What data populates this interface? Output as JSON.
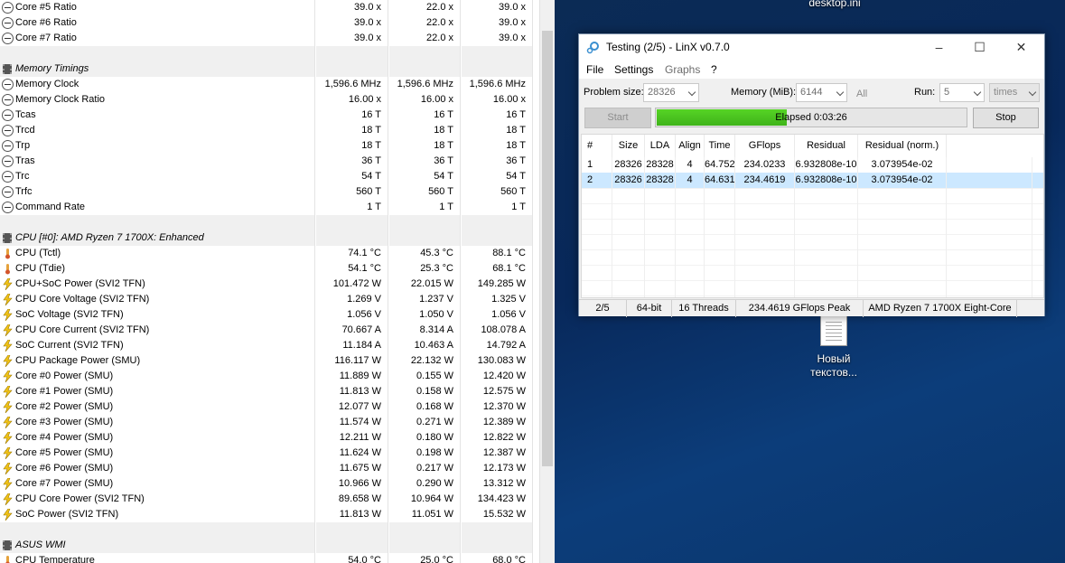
{
  "hwinfo": {
    "rows": [
      {
        "type": "sensor",
        "icon": "clock",
        "name": "Core #5 Ratio",
        "v1": "39.0 x",
        "v2": "22.0 x",
        "v3": "39.0 x"
      },
      {
        "type": "sensor",
        "icon": "clock",
        "name": "Core #6 Ratio",
        "v1": "39.0 x",
        "v2": "22.0 x",
        "v3": "39.0 x"
      },
      {
        "type": "sensor",
        "icon": "clock",
        "name": "Core #7 Ratio",
        "v1": "39.0 x",
        "v2": "22.0 x",
        "v3": "39.0 x"
      },
      {
        "type": "blank"
      },
      {
        "type": "group",
        "icon": "chip",
        "name": "Memory Timings"
      },
      {
        "type": "sensor",
        "icon": "clock",
        "name": "Memory Clock",
        "v1": "1,596.6 MHz",
        "v2": "1,596.6 MHz",
        "v3": "1,596.6 MHz"
      },
      {
        "type": "sensor",
        "icon": "clock",
        "name": "Memory Clock Ratio",
        "v1": "16.00 x",
        "v2": "16.00 x",
        "v3": "16.00 x"
      },
      {
        "type": "sensor",
        "icon": "clock",
        "name": "Tcas",
        "v1": "16 T",
        "v2": "16 T",
        "v3": "16 T"
      },
      {
        "type": "sensor",
        "icon": "clock",
        "name": "Trcd",
        "v1": "18 T",
        "v2": "18 T",
        "v3": "18 T"
      },
      {
        "type": "sensor",
        "icon": "clock",
        "name": "Trp",
        "v1": "18 T",
        "v2": "18 T",
        "v3": "18 T"
      },
      {
        "type": "sensor",
        "icon": "clock",
        "name": "Tras",
        "v1": "36 T",
        "v2": "36 T",
        "v3": "36 T"
      },
      {
        "type": "sensor",
        "icon": "clock",
        "name": "Trc",
        "v1": "54 T",
        "v2": "54 T",
        "v3": "54 T"
      },
      {
        "type": "sensor",
        "icon": "clock",
        "name": "Trfc",
        "v1": "560 T",
        "v2": "560 T",
        "v3": "560 T"
      },
      {
        "type": "sensor",
        "icon": "clock",
        "name": "Command Rate",
        "v1": "1 T",
        "v2": "1 T",
        "v3": "1 T"
      },
      {
        "type": "blank"
      },
      {
        "type": "group",
        "icon": "chip",
        "name": "CPU [#0]: AMD Ryzen 7 1700X: Enhanced"
      },
      {
        "type": "sensor",
        "icon": "temp",
        "name": "CPU (Tctl)",
        "v1": "74.1 °C",
        "v2": "45.3 °C",
        "v3": "88.1 °C"
      },
      {
        "type": "sensor",
        "icon": "temp",
        "name": "CPU (Tdie)",
        "v1": "54.1 °C",
        "v2": "25.3 °C",
        "v3": "68.1 °C"
      },
      {
        "type": "sensor",
        "icon": "volt",
        "name": "CPU+SoC Power (SVI2 TFN)",
        "v1": "101.472 W",
        "v2": "22.015 W",
        "v3": "149.285 W"
      },
      {
        "type": "sensor",
        "icon": "volt",
        "name": "CPU Core Voltage (SVI2 TFN)",
        "v1": "1.269 V",
        "v2": "1.237 V",
        "v3": "1.325 V"
      },
      {
        "type": "sensor",
        "icon": "volt",
        "name": "SoC Voltage (SVI2 TFN)",
        "v1": "1.056 V",
        "v2": "1.050 V",
        "v3": "1.056 V"
      },
      {
        "type": "sensor",
        "icon": "volt",
        "name": "CPU Core Current (SVI2 TFN)",
        "v1": "70.667 A",
        "v2": "8.314 A",
        "v3": "108.078 A"
      },
      {
        "type": "sensor",
        "icon": "volt",
        "name": "SoC Current (SVI2 TFN)",
        "v1": "11.184 A",
        "v2": "10.463 A",
        "v3": "14.792 A"
      },
      {
        "type": "sensor",
        "icon": "volt",
        "name": "CPU Package Power (SMU)",
        "v1": "116.117 W",
        "v2": "22.132 W",
        "v3": "130.083 W"
      },
      {
        "type": "sensor",
        "icon": "volt",
        "name": "Core #0 Power (SMU)",
        "v1": "11.889 W",
        "v2": "0.155 W",
        "v3": "12.420 W"
      },
      {
        "type": "sensor",
        "icon": "volt",
        "name": "Core #1 Power (SMU)",
        "v1": "11.813 W",
        "v2": "0.158 W",
        "v3": "12.575 W"
      },
      {
        "type": "sensor",
        "icon": "volt",
        "name": "Core #2 Power (SMU)",
        "v1": "12.077 W",
        "v2": "0.168 W",
        "v3": "12.370 W"
      },
      {
        "type": "sensor",
        "icon": "volt",
        "name": "Core #3 Power (SMU)",
        "v1": "11.574 W",
        "v2": "0.271 W",
        "v3": "12.389 W"
      },
      {
        "type": "sensor",
        "icon": "volt",
        "name": "Core #4 Power (SMU)",
        "v1": "12.211 W",
        "v2": "0.180 W",
        "v3": "12.822 W"
      },
      {
        "type": "sensor",
        "icon": "volt",
        "name": "Core #5 Power (SMU)",
        "v1": "11.624 W",
        "v2": "0.198 W",
        "v3": "12.387 W"
      },
      {
        "type": "sensor",
        "icon": "volt",
        "name": "Core #6 Power (SMU)",
        "v1": "11.675 W",
        "v2": "0.217 W",
        "v3": "12.173 W"
      },
      {
        "type": "sensor",
        "icon": "volt",
        "name": "Core #7 Power (SMU)",
        "v1": "10.966 W",
        "v2": "0.290 W",
        "v3": "13.312 W"
      },
      {
        "type": "sensor",
        "icon": "volt",
        "name": "CPU Core Power (SVI2 TFN)",
        "v1": "89.658 W",
        "v2": "10.964 W",
        "v3": "134.423 W"
      },
      {
        "type": "sensor",
        "icon": "volt",
        "name": "SoC Power (SVI2 TFN)",
        "v1": "11.813 W",
        "v2": "11.051 W",
        "v3": "15.532 W"
      },
      {
        "type": "blank"
      },
      {
        "type": "group",
        "icon": "chip",
        "name": "ASUS WMI"
      },
      {
        "type": "sensor",
        "icon": "temp",
        "name": "CPU Temperature",
        "v1": "54.0 °C",
        "v2": "25.0 °C",
        "v3": "68.0 °C"
      }
    ],
    "scroll_thumb_color": "#cdcdcd"
  },
  "desktop": {
    "top_label": "desktop.ini",
    "file_label": "Новый текстов...",
    "file_icon": "text-document-icon"
  },
  "linx": {
    "title": "Testing (2/5) - LinX v0.7.0",
    "window_buttons": {
      "minimize": "–",
      "maximize": "☐",
      "close": "✕"
    },
    "menu": [
      "File",
      "Settings",
      "Graphs",
      "?"
    ],
    "problem_size_label": "Problem size:",
    "problem_size_value": "28326",
    "memory_label": "Memory (MiB):",
    "memory_value": "6144",
    "all_label": "All",
    "run_label": "Run:",
    "run_value": "5",
    "times_value": "times",
    "start_label": "Start",
    "stop_label": "Stop",
    "progress_text": "Elapsed 0:03:26",
    "progress_fraction": 0.42,
    "progress_color": "#4cc41f",
    "columns": [
      "#",
      "Size",
      "LDA",
      "Align",
      "Time",
      "GFlops",
      "Residual",
      "Residual (norm.)"
    ],
    "results": [
      [
        "1",
        "28326",
        "28328",
        "4",
        "64.752",
        "234.0233",
        "6.932808e-10",
        "3.073954e-02"
      ],
      [
        "2",
        "28326",
        "28328",
        "4",
        "64.631",
        "234.4619",
        "6.932808e-10",
        "3.073954e-02"
      ]
    ],
    "selected_row": 1,
    "status": [
      "2/5",
      "64-bit",
      "16 Threads",
      "234.4619 GFlops Peak",
      "AMD Ryzen 7 1700X Eight-Core"
    ]
  }
}
